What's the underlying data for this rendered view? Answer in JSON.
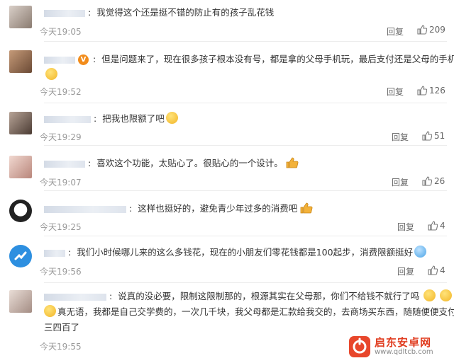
{
  "reply_label": "回复",
  "comments": [
    {
      "text": "我觉得这个还是挺不错的防止有的孩子乱花钱",
      "time": "今天19:05",
      "likes": "209"
    },
    {
      "text": "但是问题来了，现在很多孩子根本没有号，都是拿的父母手机玩，最后支付还是父母的手机",
      "time": "今天19:52",
      "likes": "126"
    },
    {
      "text": "把我也限额了吧",
      "time": "今天19:29",
      "likes": "51"
    },
    {
      "text": "喜欢这个功能，太贴心了。很贴心的一个设计。",
      "time": "今天19:07",
      "likes": "26"
    },
    {
      "text": "这样也挺好的，避免青少年过多的消费吧",
      "time": "今天19:25",
      "likes": "4"
    },
    {
      "text": "我们小时候哪儿来的这么多钱花，现在的小朋友们零花钱都是100起步，消费限额挺好",
      "time": "今天19:56",
      "likes": "4"
    },
    {
      "text": "说真的没必要，限制这限制那的，根源其实在父母那，你们不给钱不就行了吗",
      "text2": "真无语，我都是自己交学费的，一次几千块，我父母都是汇款给我交的，去商场买东西，随随便便支付就",
      "text3": "三四百了",
      "time": "今天19:55",
      "likes": "4"
    }
  ],
  "watermark": {
    "name": "启东安卓网",
    "url": "www.qdltcb.com"
  },
  "icons": {
    "like": "thumbs-up-icon",
    "vip": "vip-badge-icon",
    "emoji": "emoji-icon"
  }
}
